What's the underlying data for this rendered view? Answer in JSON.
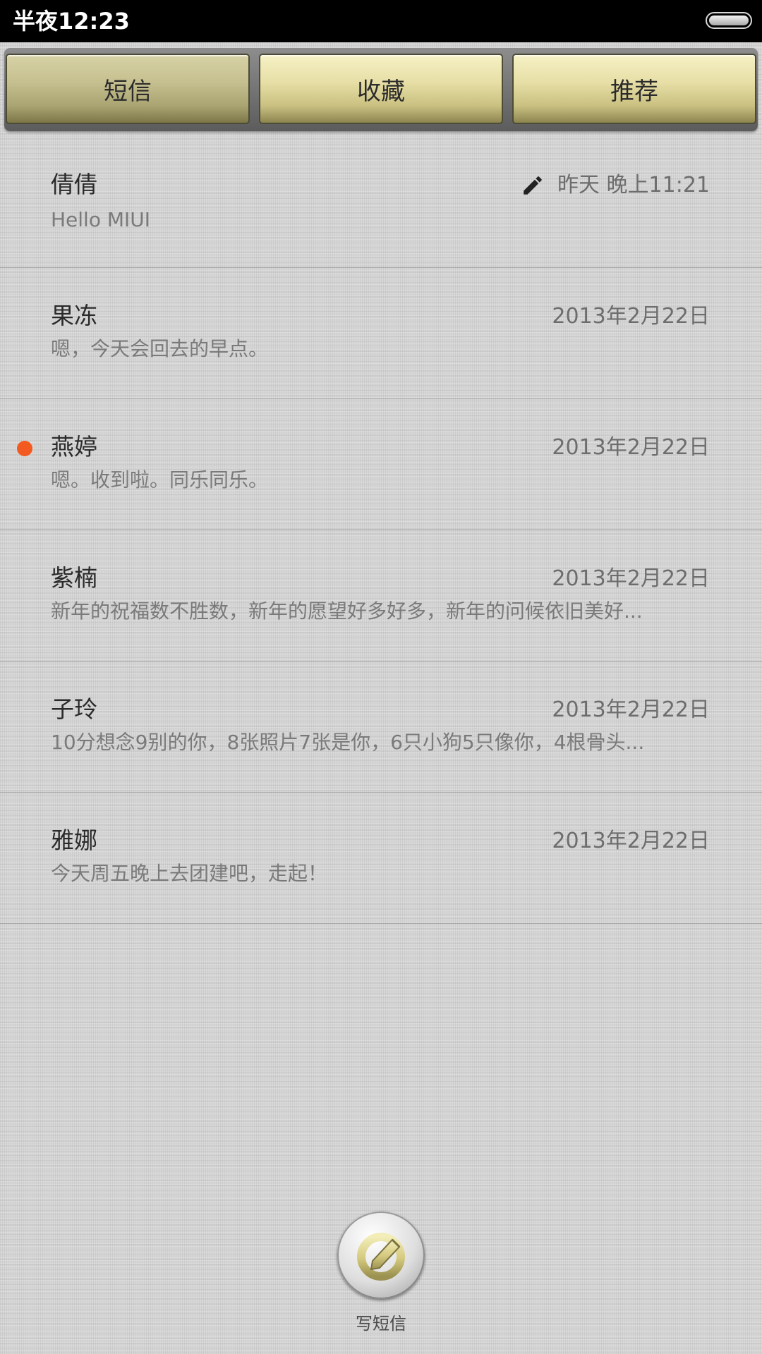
{
  "status_bar": {
    "time": "半夜12:23",
    "battery_icon": "battery-icon"
  },
  "tabs": [
    {
      "label": "短信",
      "active": true
    },
    {
      "label": "收藏",
      "active": false
    },
    {
      "label": "推荐",
      "active": false
    }
  ],
  "conversations": [
    {
      "name": "倩倩",
      "preview": "Hello MIUI",
      "date": "昨天 晚上11:21",
      "draft": true,
      "unread": false
    },
    {
      "name": "果冻",
      "preview": "嗯，今天会回去的早点。",
      "date": "2013年2月22日",
      "draft": false,
      "unread": false
    },
    {
      "name": "燕婷",
      "preview": "嗯。收到啦。同乐同乐。",
      "date": "2013年2月22日",
      "draft": false,
      "unread": true
    },
    {
      "name": "紫楠",
      "preview": "新年的祝福数不胜数，新年的愿望好多好多，新年的问候依旧美好...",
      "date": "2013年2月22日",
      "draft": false,
      "unread": false
    },
    {
      "name": "子玲",
      "preview": "10分想念9别的你，8张照片7张是你，6只小狗5只像你，4根骨头...",
      "date": "2013年2月22日",
      "draft": false,
      "unread": false
    },
    {
      "name": "雅娜",
      "preview": "今天周五晚上去团建吧，走起！",
      "date": "2013年2月22日",
      "draft": false,
      "unread": false
    }
  ],
  "compose": {
    "label": "写短信",
    "icon": "compose-icon"
  },
  "colors": {
    "unread_dot": "#f35a1f",
    "tab_gold": "#e7dfa6",
    "status_bar": "#000000"
  }
}
